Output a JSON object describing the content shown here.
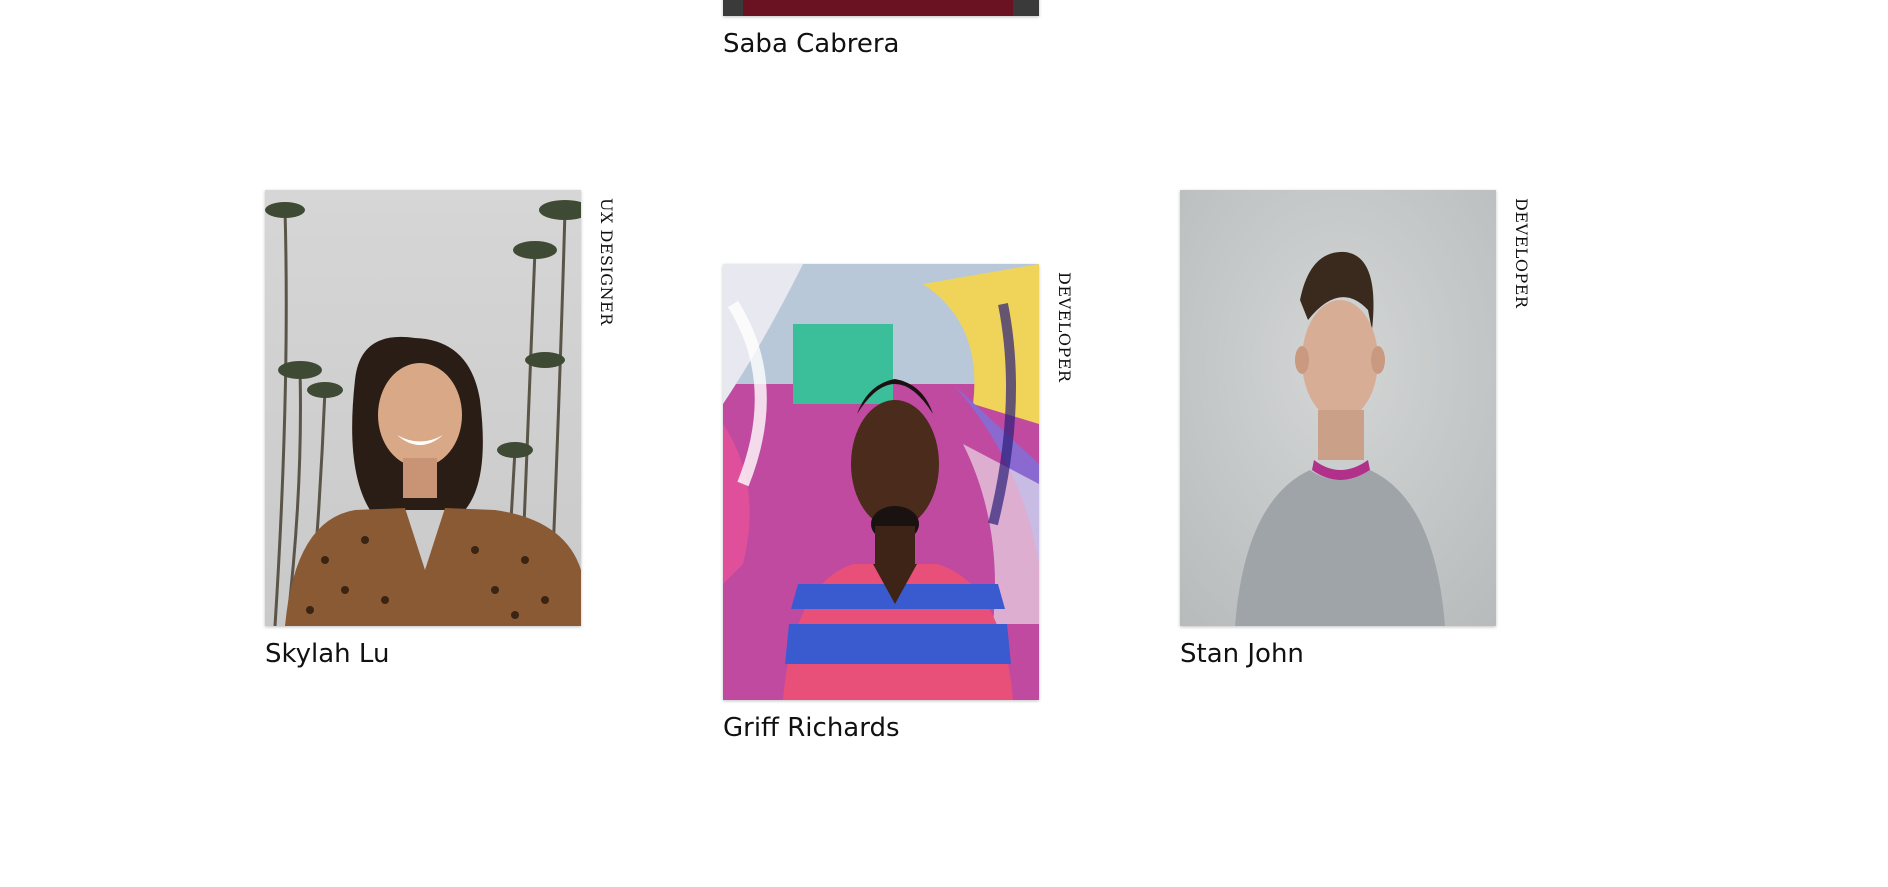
{
  "members": [
    {
      "id": "saba",
      "name": "Saba Cabrera",
      "role": ""
    },
    {
      "id": "skylah",
      "name": "Skylah Lu",
      "role": "UX DESIGNER"
    },
    {
      "id": "griff",
      "name": "Griff Richards",
      "role": "DEVELOPER"
    },
    {
      "id": "stan",
      "name": "Stan John",
      "role": "DEVELOPER"
    }
  ]
}
